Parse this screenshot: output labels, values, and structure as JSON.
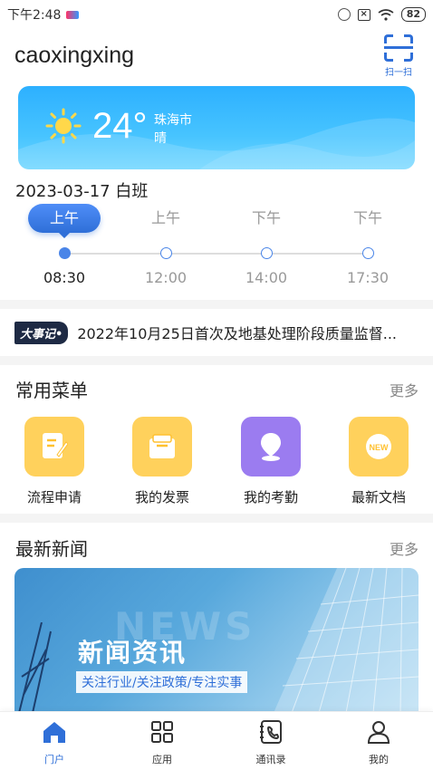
{
  "status_bar": {
    "time": "下午2:48",
    "battery": "82"
  },
  "header": {
    "username": "caoxingxing",
    "scan_label": "扫一扫"
  },
  "weather": {
    "temperature": "24°",
    "city": "珠海市",
    "condition": "晴"
  },
  "shift": {
    "date_line": "2023-03-17 白班",
    "slots": [
      {
        "label": "上午",
        "time": "08:30",
        "active": true
      },
      {
        "label": "上午",
        "time": "12:00",
        "active": false
      },
      {
        "label": "下午",
        "time": "14:00",
        "active": false
      },
      {
        "label": "下午",
        "time": "17:30",
        "active": false
      }
    ]
  },
  "events": {
    "tag": "大事记•",
    "text": "2022年10月25日首次及地基处理阶段质量监督..."
  },
  "common_menu": {
    "title": "常用菜单",
    "more": "更多",
    "items": [
      {
        "label": "流程申请",
        "icon": "process-icon",
        "color": "#ffd15c"
      },
      {
        "label": "我的发票",
        "icon": "invoice-icon",
        "color": "#ffd15c"
      },
      {
        "label": "我的考勤",
        "icon": "location-icon",
        "color": "#9b7cf0"
      },
      {
        "label": "最新文档",
        "icon": "new-doc-icon",
        "color": "#ffd15c"
      }
    ]
  },
  "news": {
    "title": "最新新闻",
    "more": "更多",
    "banner_title": "新闻资讯",
    "banner_bg_word": "NEWS",
    "banner_subtitle": "关注行业/关注政策/专注实事"
  },
  "bottom_nav": [
    {
      "label": "门户",
      "icon": "home-icon",
      "active": true
    },
    {
      "label": "应用",
      "icon": "apps-icon",
      "active": false
    },
    {
      "label": "通讯录",
      "icon": "contacts-icon",
      "active": false
    },
    {
      "label": "我的",
      "icon": "profile-icon",
      "active": false
    }
  ],
  "colors": {
    "accent": "#2f6fd8",
    "menu_yellow": "#ffd15c",
    "menu_purple": "#9b7cf0"
  }
}
